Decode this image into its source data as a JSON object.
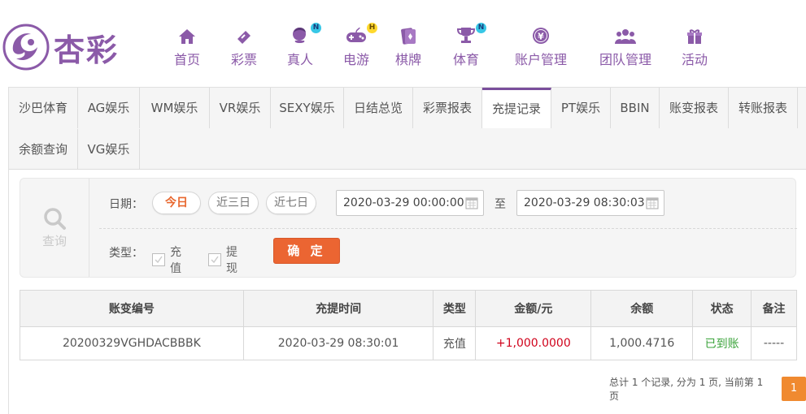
{
  "brand": {
    "name": "杏彩"
  },
  "nav": [
    {
      "label": "首页",
      "icon": "home-icon"
    },
    {
      "label": "彩票",
      "icon": "lottery-ticket-icon"
    },
    {
      "label": "真人",
      "icon": "live-dealer-icon",
      "badge": "N"
    },
    {
      "label": "电游",
      "icon": "gamepad-icon",
      "badge": "H"
    },
    {
      "label": "棋牌",
      "icon": "cards-icon"
    },
    {
      "label": "体育",
      "icon": "trophy-icon",
      "badge": "N"
    },
    {
      "label": "账户管理",
      "icon": "yen-coin-icon"
    },
    {
      "label": "团队管理",
      "icon": "team-icon"
    },
    {
      "label": "活动",
      "icon": "gift-icon"
    }
  ],
  "tabs": {
    "row1": [
      "沙巴体育",
      "AG娱乐",
      "WM娱乐",
      "VR娱乐",
      "SEXY娱乐",
      "日结总览",
      "彩票报表",
      "充提记录",
      "PT娱乐",
      "BBIN",
      "账变报表",
      "转账报表"
    ],
    "row2": [
      "余额查询",
      "VG娱乐"
    ],
    "active": "充提记录"
  },
  "search": {
    "title": "查询",
    "date_label": "日期：",
    "quick": [
      "今日",
      "近三日",
      "近七日"
    ],
    "active_quick": "今日",
    "start": "2020-03-29 00:00:00",
    "to": "至",
    "end": "2020-03-29 08:30:03",
    "type_label": "类型：",
    "types": [
      "充值",
      "提现"
    ],
    "confirm": "确 定"
  },
  "table": {
    "headers": [
      "账变编号",
      "充提时间",
      "类型",
      "金额/元",
      "余额",
      "状态",
      "备注"
    ],
    "rows": [
      [
        "20200329VGHDACBBBK",
        "2020-03-29 08:30:01",
        "充值",
        "+1,000.0000",
        "1,000.4716",
        "已到账",
        "-----"
      ]
    ]
  },
  "pager": {
    "summary": "总计 1 个记录, 分为 1 页, 当前第 1 页",
    "page": "1"
  },
  "colors": {
    "brand": "#8b5aa8",
    "accent": "#eb6532",
    "amount": "#d0021b",
    "status_ok": "#3aa33a"
  }
}
